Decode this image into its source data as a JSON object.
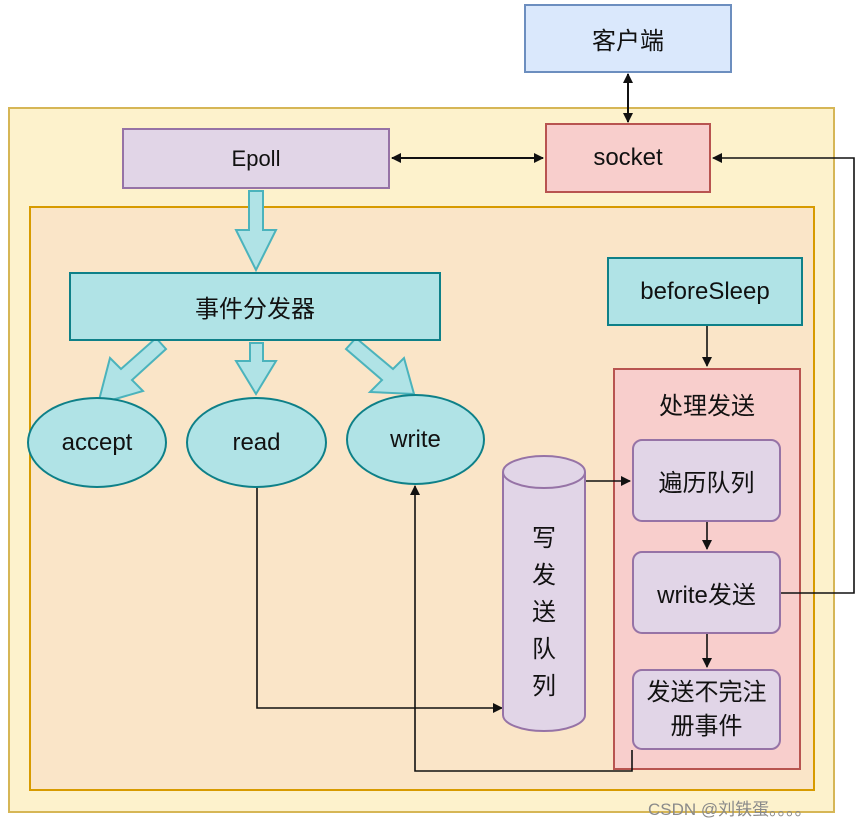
{
  "diagram": {
    "client": "客户端",
    "epoll": "Epoll",
    "socket": "socket",
    "dispatcher": "事件分发器",
    "handlers": {
      "accept": "accept",
      "read": "read",
      "write": "write"
    },
    "queue": "写发送队列",
    "before_sleep": "beforeSleep",
    "process": {
      "title": "处理发送",
      "steps": [
        "遍历队列",
        "write发送",
        "发送不完注册事件"
      ]
    }
  },
  "watermark": "CSDN @刘铁蛋。。。。",
  "colors": {
    "outer_frame": "#fdf2cc",
    "inner_frame": "#fae5c8",
    "client": "#dae8fc",
    "epoll": "#e1d5e7",
    "socket": "#f8cecc",
    "teal": "#b0e3e6",
    "lavender": "#e1d5e7"
  }
}
